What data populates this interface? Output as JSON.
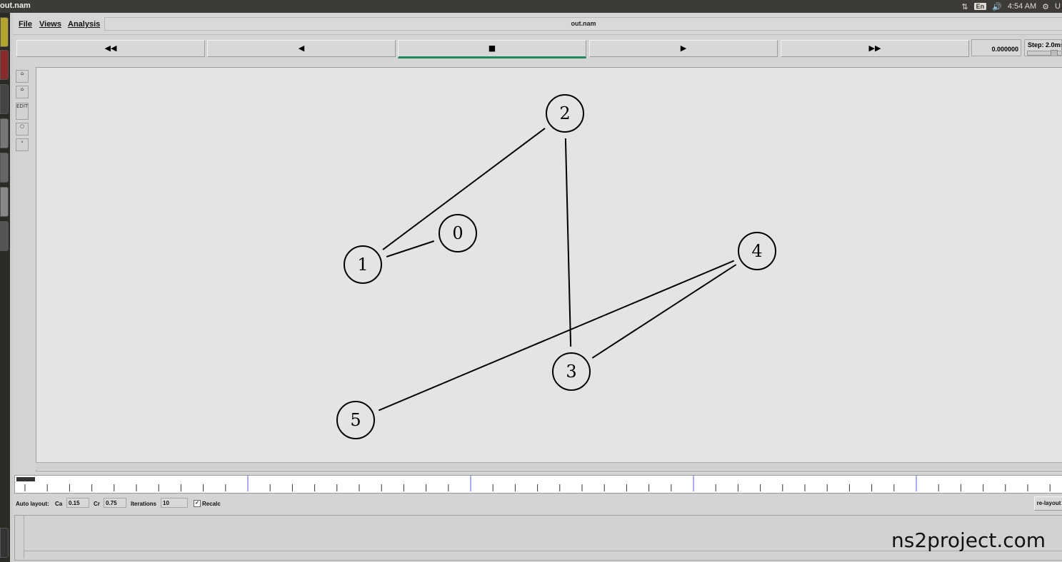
{
  "window": {
    "title": "out.nam"
  },
  "topbar": {
    "keyboard": "En",
    "clock": "4:54 AM",
    "user_initial": "U"
  },
  "menubar": {
    "items": [
      "File",
      "Views",
      "Analysis"
    ],
    "filename": "out.nam"
  },
  "transport": {
    "rewind": "◀◀",
    "back": "◀",
    "stop": "■",
    "play": "▶",
    "fastforward": "▶▶",
    "time": "0.000000",
    "step": "Step: 2.0ms"
  },
  "tools": {
    "edit": "EDIT"
  },
  "network": {
    "nodes": [
      {
        "id": "0",
        "label": "0"
      },
      {
        "id": "1",
        "label": "1"
      },
      {
        "id": "2",
        "label": "2"
      },
      {
        "id": "3",
        "label": "3"
      },
      {
        "id": "4",
        "label": "4"
      },
      {
        "id": "5",
        "label": "5"
      }
    ],
    "links": [
      [
        "1",
        "0"
      ],
      [
        "1",
        "2"
      ],
      [
        "2",
        "3"
      ],
      [
        "3",
        "4"
      ],
      [
        "4",
        "5"
      ]
    ]
  },
  "autolayout": {
    "label": "Auto layout:",
    "ca_label": "Ca",
    "ca_value": "0.15",
    "cr_label": "Cr",
    "cr_value": "0.75",
    "iter_label": "Iterations",
    "iter_value": "10",
    "recalc_label": "Recalc",
    "relayout_label": "re-layout"
  },
  "watermark": "ns2project.com"
}
